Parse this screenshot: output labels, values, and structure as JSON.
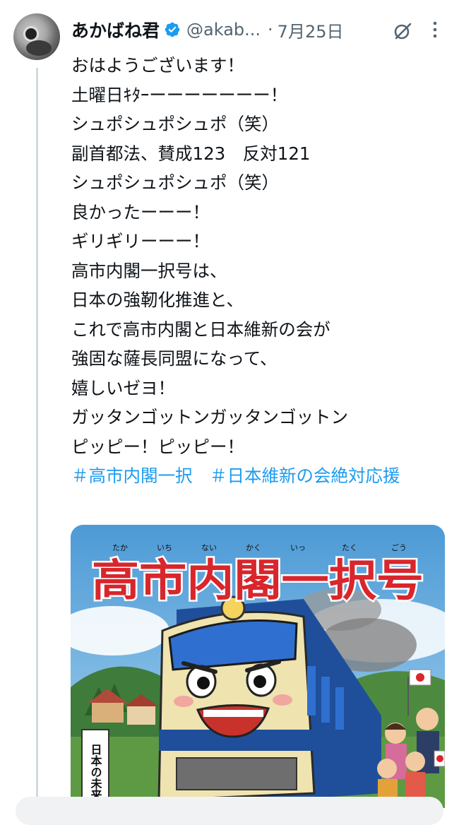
{
  "post": {
    "author_name": "あかばね君",
    "handle": "@akab...",
    "separator": "·",
    "date": "7月25日",
    "lines": [
      "おはようございます！",
      "土曜日ｷﾀｰーーーーーーー！",
      "シュポシュポシュポ（笑）",
      "副首都法、賛成123　反対121",
      "シュポシュポシュポ（笑）",
      "良かったーーー！",
      "ギリギリーーー！",
      "高市内閣一択号は、",
      "日本の強靭化推進と、",
      "これで高市内閣と日本維新の会が",
      "強固な薩長同盟になって、",
      "嬉しいゼヨ！",
      "ガッタンゴットンガッタンゴットン",
      "ピッピー！ピッピー！"
    ],
    "hashtags": [
      "＃高市内閣一択",
      "＃日本維新の会絶対応援"
    ]
  },
  "image": {
    "title": "高市内閣一択号",
    "ruby": [
      "たか",
      "いち",
      "ない",
      "かく",
      "いっ",
      "たく",
      "ごう"
    ],
    "signpost": "日本の未来へ"
  },
  "icons": {
    "verified": "verified-badge-icon",
    "grok": "grok-icon",
    "more": "more-options-icon"
  },
  "colors": {
    "link": "#1d9bf0",
    "secondary": "#536471",
    "title_red": "#d8262c"
  }
}
